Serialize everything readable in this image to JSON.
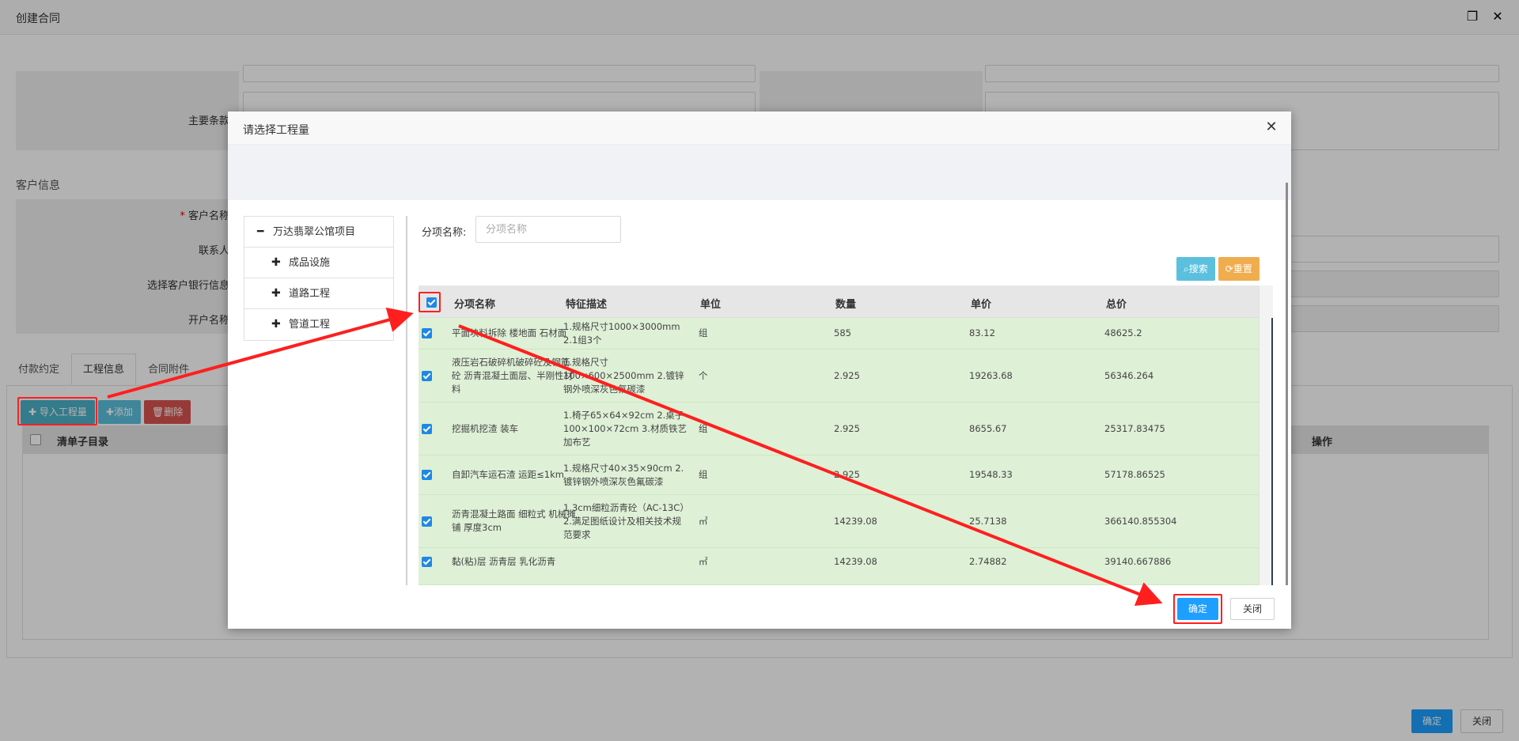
{
  "window": {
    "title": "创建合同",
    "restore_icon": "restore-icon",
    "close_icon": "close-icon"
  },
  "form": {
    "main_terms_label": "主要条款",
    "customer_section_title": "客户信息",
    "customer_name_label": "客户名称",
    "contact_label": "联系人",
    "bank_info_label": "选择客户银行信息",
    "account_name_label": "开户名称"
  },
  "tabs": [
    {
      "label": "付款约定"
    },
    {
      "label": "工程信息"
    },
    {
      "label": "合同附件"
    }
  ],
  "tools": {
    "import_label": "导入工程量",
    "add_label": "添加",
    "delete_label": "删除"
  },
  "bg_grid": {
    "col_catalog": "清单子目录",
    "col_action": "操作"
  },
  "footer": {
    "ok_label": "确定",
    "close_label": "关闭"
  },
  "modal": {
    "title": "请选择工程量",
    "tree": {
      "root": "万达翡翠公馆项目",
      "children": [
        "成品设施",
        "道路工程",
        "管道工程"
      ]
    },
    "search": {
      "label": "分项名称:",
      "placeholder": "分项名称",
      "value": ""
    },
    "search_button": "搜索",
    "reset_button": "重置",
    "columns": [
      "分项名称",
      "特征描述",
      "单位",
      "数量",
      "单价",
      "总价"
    ],
    "rows": [
      {
        "checked": true,
        "name": "平面块料拆除 楼地面 石材面",
        "desc": "1.规格尺寸1000×3000mm 2.1组3个",
        "unit": "组",
        "qty": "585",
        "price": "83.12",
        "total": "48625.2"
      },
      {
        "checked": true,
        "name": "液压岩石破碎机破碎砼及钢筋砼 沥青混凝土面层、半刚性材料",
        "desc": "1.规格尺寸100×600×2500mm 2.镀锌钢外喷深灰色氟碳漆",
        "unit": "个",
        "qty": "2.925",
        "price": "19263.68",
        "total": "56346.264"
      },
      {
        "checked": true,
        "name": "挖掘机挖渣 装车",
        "desc": "1.椅子65×64×92cm 2.桌子100×100×72cm 3.材质铁艺加布艺",
        "unit": "组",
        "qty": "2.925",
        "price": "8655.67",
        "total": "25317.83475"
      },
      {
        "checked": true,
        "name": "自卸汽车运石渣 运距≤1km",
        "desc": "1.规格尺寸40×35×90cm 2.镀锌钢外喷深灰色氟碳漆",
        "unit": "组",
        "qty": "2.925",
        "price": "19548.33",
        "total": "57178.86525"
      },
      {
        "checked": true,
        "name": "沥青混凝土路面 细粒式 机械摊铺 厚度3cm",
        "desc": "1.3cm细粒沥青砼（AC-13C）2.满足图纸设计及相关技术规范要求",
        "unit": "㎡",
        "qty": "14239.08",
        "price": "25.7138",
        "total": "366140.855304"
      },
      {
        "checked": true,
        "name": "黏(粘)层 沥青层 乳化沥青",
        "desc": "",
        "unit": "㎡",
        "qty": "14239.08",
        "price": "2.74882",
        "total": "39140.667886"
      }
    ],
    "ok_label": "确定",
    "close_label": "关闭"
  },
  "colors": {
    "row_selected": "#def0d6",
    "primary": "#1e9fff",
    "annotation": "#ff1f1f"
  }
}
